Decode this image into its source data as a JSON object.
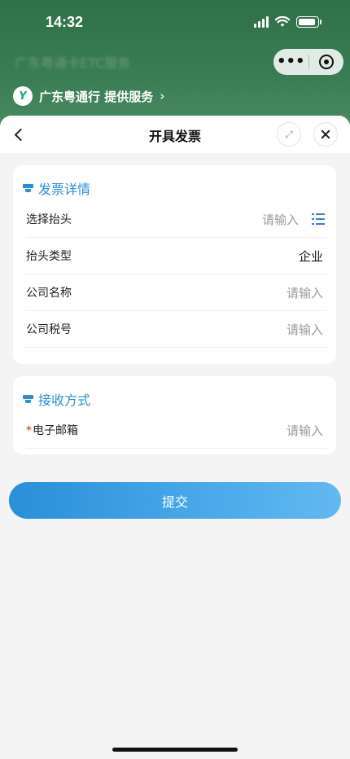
{
  "status_bar": {
    "time": "14:32"
  },
  "background": {
    "app_title": "广东粤通卡ETC服务",
    "provider": "广东粤通行 提供服务",
    "provider_chevron": "›",
    "capsule_more": "•••"
  },
  "sheet": {
    "title": "开具发票",
    "expand_glyph": "⤢"
  },
  "invoice_details": {
    "section_title": "发票详情",
    "rows": [
      {
        "label": "选择抬头",
        "value": "请输入",
        "filled": false,
        "has_list_icon": true
      },
      {
        "label": "抬头类型",
        "value": "企业",
        "filled": true
      },
      {
        "label": "公司名称",
        "value": "请输入",
        "filled": false
      },
      {
        "label": "公司税号",
        "value": "请输入",
        "filled": false
      }
    ]
  },
  "receive_method": {
    "section_title": "接收方式",
    "rows": [
      {
        "label": "电子邮箱",
        "required_mark": "*",
        "value": "请输入",
        "filled": false
      }
    ]
  },
  "submit_label": "提交",
  "colors": {
    "accent": "#2b8fd6",
    "background_green": "#2f7049",
    "required": "#e02020"
  }
}
